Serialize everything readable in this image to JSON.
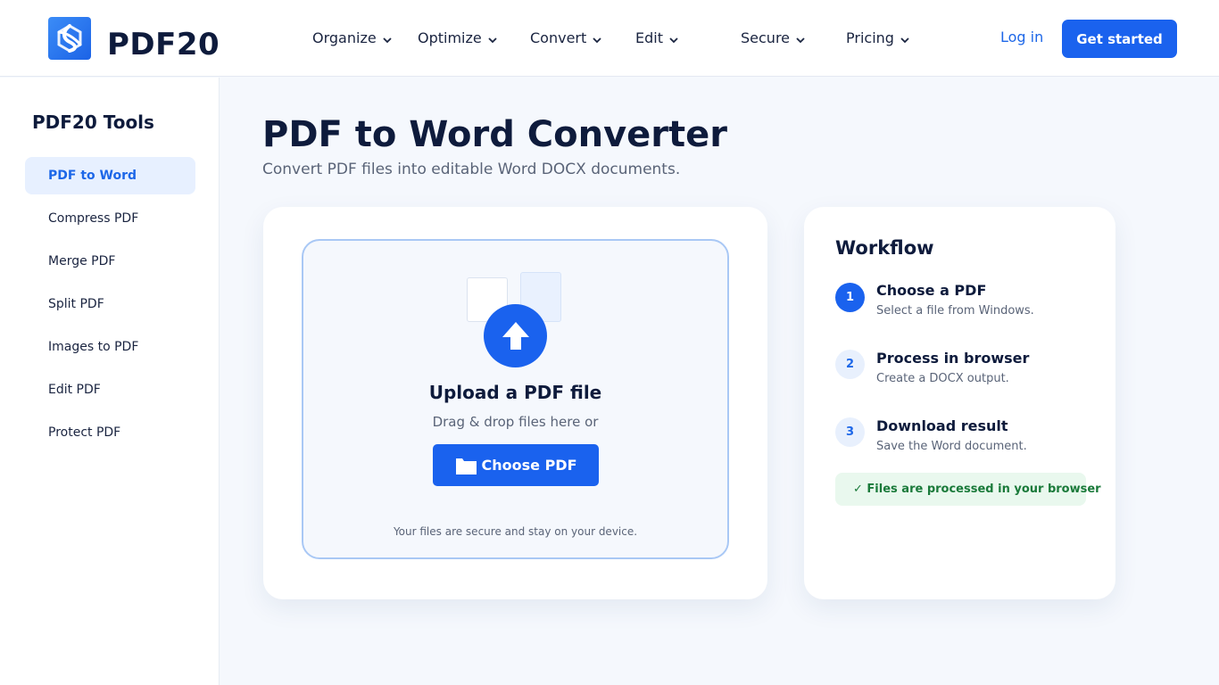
{
  "header": {
    "brand": "PDF20",
    "nav": [
      {
        "label": "Organize"
      },
      {
        "label": "Optimize"
      },
      {
        "label": "Convert"
      },
      {
        "label": "Edit"
      },
      {
        "label": "Secure"
      },
      {
        "label": "Pricing"
      }
    ],
    "login_label": "Log in",
    "cta_label": "Get started"
  },
  "sidebar": {
    "title": "PDF20 Tools",
    "items": [
      {
        "label": "PDF to Word",
        "active": true
      },
      {
        "label": "Compress PDF"
      },
      {
        "label": "Merge PDF"
      },
      {
        "label": "Split PDF"
      },
      {
        "label": "Images to PDF"
      },
      {
        "label": "Edit PDF"
      },
      {
        "label": "Protect PDF"
      }
    ]
  },
  "main": {
    "title": "PDF to Word Converter",
    "subtitle": "Convert PDF files into editable Word DOCX documents.",
    "upload": {
      "title": "Upload a PDF file",
      "drag_text": "Drag & drop files here or",
      "button_label": "Choose PDF",
      "secure_note": "Your files are secure and stay on your device."
    },
    "workflow": {
      "title": "Workflow",
      "steps": [
        {
          "num": "1",
          "title": "Choose a PDF",
          "desc": "Select a file from Windows."
        },
        {
          "num": "2",
          "title": "Process in browser",
          "desc": "Create a DOCX output."
        },
        {
          "num": "3",
          "title": "Download result",
          "desc": "Save the Word document."
        }
      ],
      "badge": "✓ Files are processed in your browser"
    }
  },
  "colors": {
    "accent": "#1a62ee",
    "text": "#0e1b3c",
    "muted": "#5a6478",
    "success": "#1a7a3a",
    "success_bg": "#e9f8ee"
  },
  "icons": {
    "logo": "pdf20-logo-icon",
    "chevron": "chevron-down-icon",
    "upload": "upload-arrow-icon",
    "folder": "folder-icon"
  }
}
